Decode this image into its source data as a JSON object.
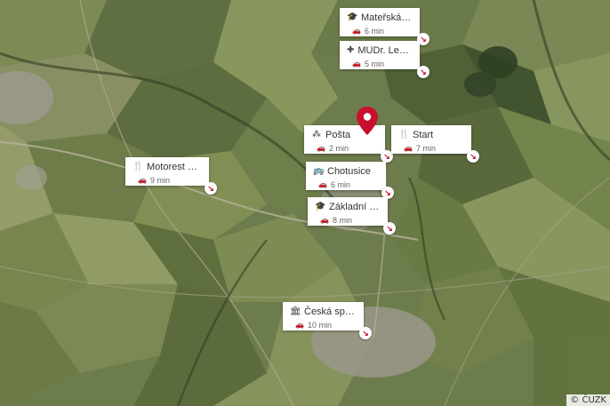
{
  "map": {
    "copyright": "© ČUZK",
    "pin_color": "#c8102e",
    "pois": [
      {
        "id": "materska",
        "icon": "school-icon",
        "glyph": "🎓",
        "name": "Mateřská škola Ž...",
        "time": "6 min"
      },
      {
        "id": "mudr",
        "icon": "medical-icon",
        "glyph": "✚",
        "name": "MUDr. Lebedová ...",
        "time": "5 min"
      },
      {
        "id": "posta",
        "icon": "post-office-icon",
        "glyph": "⁂",
        "name": "Pošta",
        "time": "2 min"
      },
      {
        "id": "start",
        "icon": "restaurant-icon",
        "glyph": "🍴",
        "name": "Start",
        "time": "7 min"
      },
      {
        "id": "motorest",
        "icon": "restaurant-icon",
        "glyph": "🍴",
        "name": "Motorest Vosrkáč",
        "time": "9 min"
      },
      {
        "id": "chotusice",
        "icon": "bus-icon",
        "glyph": "🚌",
        "name": "Chotusice",
        "time": "6 min"
      },
      {
        "id": "zakladni",
        "icon": "school-icon",
        "glyph": "🎓",
        "name": "Základní škola Ch...",
        "time": "8 min"
      },
      {
        "id": "sporitelna",
        "icon": "bank-icon",
        "glyph": "🏛",
        "name": "Česká spořitelna",
        "time": "10 min"
      }
    ]
  }
}
